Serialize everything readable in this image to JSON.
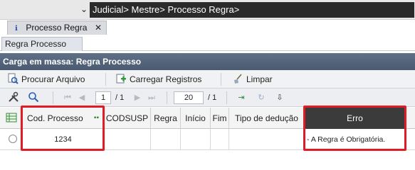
{
  "breadcrumb": {
    "text": "Judicial> Mestre> Processo Regra>",
    "chevron": "⌄"
  },
  "tab": {
    "label": "Processo Regra",
    "close": "✕",
    "icon": "info-icon"
  },
  "subtab": {
    "label": "Regra Processo"
  },
  "panel": {
    "title": "Carga em massa: Regra Processo"
  },
  "toolbar": {
    "procurar_label": "Procurar Arquivo",
    "carregar_label": "Carregar Registros",
    "limpar_label": "Limpar"
  },
  "pager": {
    "page": "1",
    "page_total": "/ 1",
    "page_size": "20",
    "size_total": "/ 1"
  },
  "grid": {
    "columns": [
      "Cod. Processo",
      "CODSUSP",
      "Regra",
      "Início",
      "Fim",
      "Tipo de dedução",
      "Erro"
    ],
    "rows": [
      {
        "cod_processo": "1234",
        "codsusp": "",
        "regra": "",
        "inicio": "",
        "fim": "",
        "tipo_deducao": "",
        "erro": "- A Regra é Obrigatória."
      }
    ]
  },
  "colors": {
    "header_band": "#52627a",
    "highlight": "#e01b24",
    "dark_header": "#3b3b3b"
  }
}
